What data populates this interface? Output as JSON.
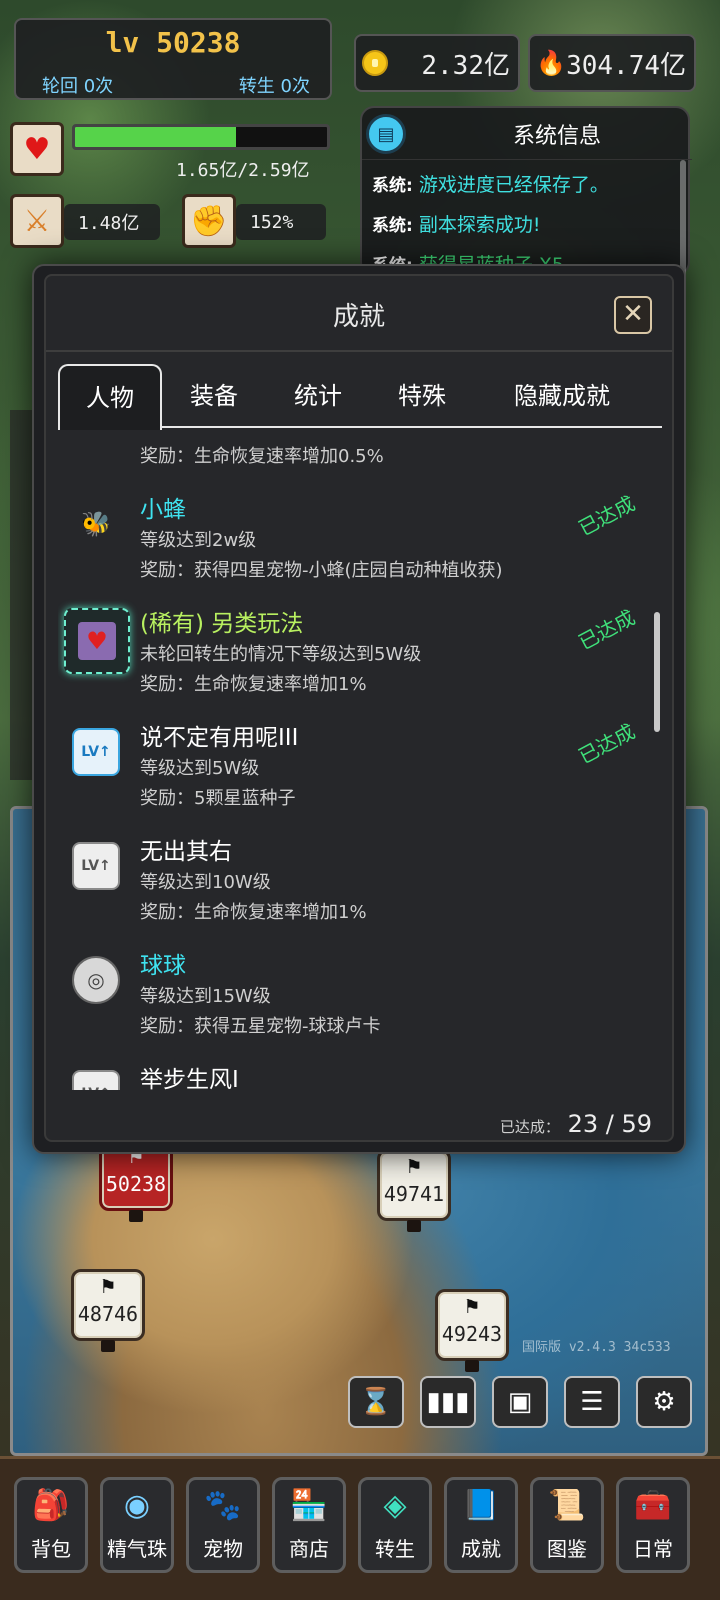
{
  "hud": {
    "level": "lv 50238",
    "reincarnation": "轮回 0次",
    "rebirth": "转生 0次",
    "gold": "2.32亿",
    "power": "304.74亿",
    "hp_text": "1.65亿/2.59亿",
    "hp_ratio": 0.637,
    "attack": "1.48亿",
    "crit": "152%"
  },
  "system_info": {
    "title": "系统信息",
    "messages": [
      {
        "label": "系统:",
        "text": "游戏进度已经保存了。"
      },
      {
        "label": "系统:",
        "text": "副本探索成功!"
      },
      {
        "label": "系统:",
        "text": "获得星蓝种子 X5"
      }
    ]
  },
  "modal": {
    "title": "成就",
    "tabs": [
      "人物",
      "装备",
      "统计",
      "特殊",
      "隐藏成就"
    ],
    "active_tab": "人物",
    "items": [
      {
        "name": "",
        "req": "",
        "reward": "奖励：生命恢复速率增加0.5%",
        "done": ""
      },
      {
        "name": "小蜂",
        "req": "等级达到2w级",
        "reward": "奖励：获得四星宠物-小蜂(庄园自动种植收获)",
        "done": "已达成",
        "color": "cyan",
        "icon": "bee-pet-icon"
      },
      {
        "name": "(稀有) 另类玩法",
        "req": "未轮回转生的情况下等级达到5W级",
        "reward": "奖励：生命恢复速率增加1%",
        "done": "已达成",
        "color": "lime",
        "icon": "rare-heart-icon"
      },
      {
        "name": "说不定有用呢III",
        "req": "等级达到5W级",
        "reward": "奖励：5颗星蓝种子",
        "done": "已达成",
        "color": "white",
        "icon": "level-up-icon"
      },
      {
        "name": "无出其右",
        "req": "等级达到10W级",
        "reward": "奖励：生命恢复速率增加1%",
        "done": "",
        "color": "white",
        "icon": "level-up-icon"
      },
      {
        "name": "球球",
        "req": "等级达到15W级",
        "reward": "奖励：获得五星宠物-球球卢卡",
        "done": "",
        "color": "cyan",
        "icon": "ball-pet-icon"
      },
      {
        "name": "举步生风I",
        "req": "",
        "reward": "",
        "done": "",
        "color": "white",
        "icon": "level-up-icon"
      }
    ],
    "count_label": "已达成：",
    "count_value": "23 / 59"
  },
  "map": {
    "markers": [
      "50238",
      "49741",
      "48746",
      "49243"
    ],
    "version": "国际版 v2.4.3  34c533"
  },
  "bottom_nav": [
    "背包",
    "精气珠",
    "宠物",
    "商店",
    "转生",
    "成就",
    "图鉴",
    "日常"
  ]
}
